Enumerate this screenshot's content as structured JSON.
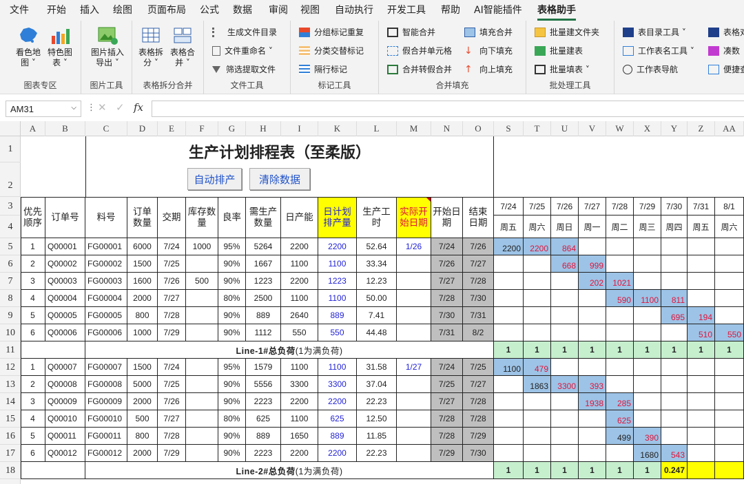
{
  "menu": [
    "文件",
    "开始",
    "插入",
    "绘图",
    "页面布局",
    "公式",
    "数据",
    "审阅",
    "视图",
    "自动执行",
    "开发工具",
    "帮助",
    "AI智能插件",
    "表格助手"
  ],
  "ribbon": {
    "g1": {
      "b1": "看色地图 ˅",
      "b2": "特色图表 ˅",
      "label": "图表专区"
    },
    "g2": {
      "b1": "图片插入导出 ˅",
      "label": "图片工具"
    },
    "g3": {
      "b1": "表格拆分 ˅",
      "b2": "表格合并 ˅",
      "label": "表格拆分合并"
    },
    "g4": {
      "i1": "生成文件目录",
      "i2": "文件重命名 ˅",
      "i3": "筛选提取文件",
      "label": "文件工具"
    },
    "g5": {
      "i1": "分组标记重复",
      "i2": "分类交替标记",
      "i3": "隔行标记",
      "label": "标记工具"
    },
    "g6": {
      "i1": "智能合并",
      "i2": "假合并单元格",
      "i3": "合并转假合并",
      "i4": "填充合并",
      "i5": "向下填充",
      "i6": "向上填充",
      "label": "合并填充"
    },
    "g7": {
      "i1": "批量建文件夹",
      "i2": "批量建表",
      "i3": "批量填表 ˅",
      "label": "批处理工具"
    },
    "g8": {
      "i1": "表目录工具 ˅",
      "i2": "工作表名工具 ˅",
      "i3": "工作表导航",
      "i4": "表格对",
      "i5": "凑数",
      "i6": "便捷查"
    }
  },
  "formula": {
    "namebox": "AM31",
    "fx": "fx",
    "value": ""
  },
  "colheads": [
    "A",
    "B",
    "C",
    "D",
    "E",
    "F",
    "G",
    "H",
    "I",
    "K",
    "L",
    "M",
    "N",
    "O",
    "S",
    "T",
    "U",
    "V",
    "W",
    "X",
    "Y",
    "Z",
    "AA"
  ],
  "rowheads": [
    "1",
    "2",
    "3",
    "4",
    "5",
    "6",
    "7",
    "8",
    "9",
    "10",
    "11",
    "12",
    "13",
    "14",
    "15",
    "16",
    "17",
    "18"
  ],
  "title": "生产计划排程表（至柔版）",
  "buttons": {
    "auto": "自动排产",
    "clear": "清除数据"
  },
  "headers": {
    "seq": "优先顺序",
    "order": "订单号",
    "part": "料号",
    "qty": "订单数量",
    "due": "交期",
    "stock": "库存数量",
    "yield": "良率",
    "need": "需生产数量",
    "cap": "日产能",
    "plan": "日计划排产量",
    "hours": "生产工时",
    "actual": "实际开始日期",
    "start": "开始日期",
    "end": "结束日期"
  },
  "dates": [
    "7/24",
    "7/25",
    "7/26",
    "7/27",
    "7/28",
    "7/29",
    "7/30",
    "7/31",
    "8/1"
  ],
  "weekdays": [
    "周五",
    "周六",
    "周日",
    "周一",
    "周二",
    "周三",
    "周四",
    "周五",
    "周六"
  ],
  "line1": [
    [
      "1",
      "Q00001",
      "FG00001",
      "6000",
      "7/24",
      "1000",
      "95%",
      "5264",
      "2200",
      "2200",
      "52.64",
      "1/26",
      "7/24",
      "7/26"
    ],
    [
      "2",
      "Q00002",
      "FG00002",
      "1500",
      "7/25",
      "",
      "90%",
      "1667",
      "1100",
      "1100",
      "33.34",
      "",
      "7/26",
      "7/27"
    ],
    [
      "3",
      "Q00003",
      "FG00003",
      "1600",
      "7/26",
      "500",
      "90%",
      "1223",
      "2200",
      "1223",
      "12.23",
      "",
      "7/27",
      "7/28"
    ],
    [
      "4",
      "Q00004",
      "FG00004",
      "2000",
      "7/27",
      "",
      "80%",
      "2500",
      "1100",
      "1100",
      "50.00",
      "",
      "7/28",
      "7/30"
    ],
    [
      "5",
      "Q00005",
      "FG00005",
      "800",
      "7/28",
      "",
      "90%",
      "889",
      "2640",
      "889",
      "7.41",
      "",
      "7/30",
      "7/31"
    ],
    [
      "6",
      "Q00006",
      "FG00006",
      "1000",
      "7/29",
      "",
      "90%",
      "1112",
      "550",
      "550",
      "44.48",
      "",
      "7/31",
      "8/2"
    ]
  ],
  "line2": [
    [
      "1",
      "Q00007",
      "FG00007",
      "1500",
      "7/24",
      "",
      "95%",
      "1579",
      "1100",
      "1100",
      "31.58",
      "1/27",
      "7/24",
      "7/25"
    ],
    [
      "2",
      "Q00008",
      "FG00008",
      "5000",
      "7/25",
      "",
      "90%",
      "5556",
      "3300",
      "3300",
      "37.04",
      "",
      "7/25",
      "7/27"
    ],
    [
      "3",
      "Q00009",
      "FG00009",
      "2000",
      "7/26",
      "",
      "90%",
      "2223",
      "2200",
      "2200",
      "22.23",
      "",
      "7/27",
      "7/28"
    ],
    [
      "4",
      "Q00010",
      "FG00010",
      "500",
      "7/27",
      "",
      "80%",
      "625",
      "1100",
      "625",
      "12.50",
      "",
      "7/28",
      "7/28"
    ],
    [
      "5",
      "Q00011",
      "FG00011",
      "800",
      "7/28",
      "",
      "90%",
      "889",
      "1650",
      "889",
      "11.85",
      "",
      "7/28",
      "7/29"
    ],
    [
      "6",
      "Q00012",
      "FG00012",
      "2000",
      "7/29",
      "",
      "90%",
      "2223",
      "2200",
      "2200",
      "22.23",
      "",
      "7/29",
      "7/30"
    ]
  ],
  "gantt1": [
    [
      {
        "v": "2200",
        "c": "k"
      },
      {
        "v": "2200",
        "c": "r"
      },
      {
        "v": "864",
        "c": "r"
      },
      null,
      null,
      null,
      null,
      null,
      null
    ],
    [
      null,
      null,
      {
        "v": "668",
        "c": "r"
      },
      {
        "v": "999",
        "c": "r"
      },
      null,
      null,
      null,
      null,
      null
    ],
    [
      null,
      null,
      null,
      {
        "v": "202",
        "c": "r"
      },
      {
        "v": "1021",
        "c": "r"
      },
      null,
      null,
      null,
      null
    ],
    [
      null,
      null,
      null,
      null,
      {
        "v": "590",
        "c": "r"
      },
      {
        "v": "1100",
        "c": "r"
      },
      {
        "v": "811",
        "c": "r"
      },
      null,
      null
    ],
    [
      null,
      null,
      null,
      null,
      null,
      null,
      {
        "v": "695",
        "c": "r"
      },
      {
        "v": "194",
        "c": "r"
      },
      null
    ],
    [
      null,
      null,
      null,
      null,
      null,
      null,
      null,
      {
        "v": "510",
        "c": "r"
      },
      {
        "v": "550",
        "c": "r"
      }
    ]
  ],
  "gantt2": [
    [
      {
        "v": "1100",
        "c": "k"
      },
      {
        "v": "479",
        "c": "r"
      },
      null,
      null,
      null,
      null,
      null,
      null,
      null
    ],
    [
      null,
      {
        "v": "1863",
        "c": "k"
      },
      {
        "v": "3300",
        "c": "r"
      },
      {
        "v": "393",
        "c": "r"
      },
      null,
      null,
      null,
      null,
      null
    ],
    [
      null,
      null,
      null,
      {
        "v": "1938",
        "c": "r"
      },
      {
        "v": "285",
        "c": "r"
      },
      null,
      null,
      null,
      null
    ],
    [
      null,
      null,
      null,
      null,
      {
        "v": "625",
        "c": "r"
      },
      null,
      null,
      null,
      null
    ],
    [
      null,
      null,
      null,
      null,
      {
        "v": "499",
        "c": "k"
      },
      {
        "v": "390",
        "c": "r"
      },
      null,
      null,
      null
    ],
    [
      null,
      null,
      null,
      null,
      null,
      {
        "v": "1680",
        "c": "k"
      },
      {
        "v": "543",
        "c": "r"
      },
      null,
      null
    ]
  ],
  "load1": {
    "label": "Line-1#总负荷",
    "note": "(1为满负荷)",
    "values": [
      "1",
      "1",
      "1",
      "1",
      "1",
      "1",
      "1",
      "1",
      "1"
    ]
  },
  "load2": {
    "label": "Line-2#总负荷",
    "note": "(1为满负荷)",
    "values": [
      "1",
      "1",
      "1",
      "1",
      "1",
      "1",
      "0.247",
      "",
      ""
    ]
  }
}
